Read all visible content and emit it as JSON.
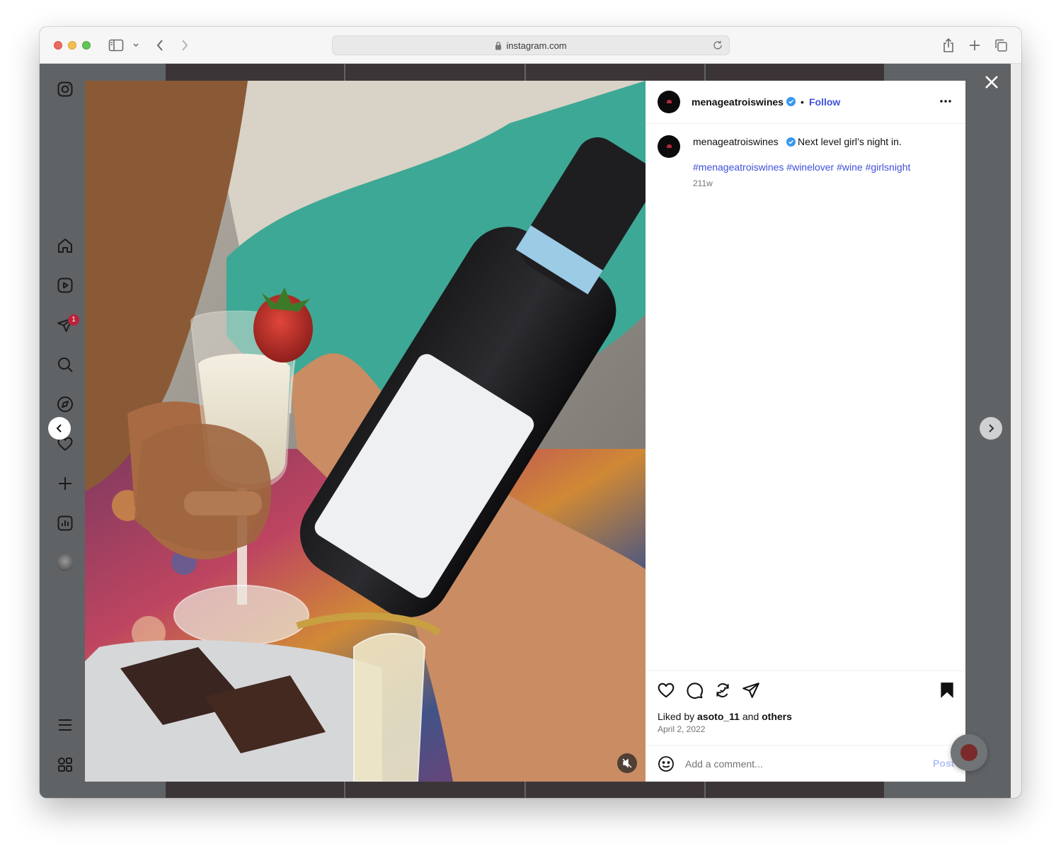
{
  "browser": {
    "url": "instagram.com"
  },
  "sidebar": {
    "notifications_badge": "1"
  },
  "post": {
    "author": "menageatroiswines",
    "follow_label": "Follow",
    "separator": "•",
    "caption": "Next level girl’s night in.",
    "hashtags": "#menageatroiswines #winelover #wine #girlsnight",
    "age": "211w",
    "liked_by_prefix": "Liked by",
    "liked_by_user": "asoto_11",
    "liked_by_and": "and",
    "liked_by_others": "others",
    "date": "April 2, 2022"
  },
  "comment": {
    "placeholder": "Add a comment...",
    "post_label": "Post"
  },
  "colors": {
    "link_blue": "#3f51d9",
    "verified_blue": "#3897f0",
    "overlay_gray": "#606366",
    "badge_red": "#b9233b"
  },
  "icons": {
    "sidebar": [
      "instagram-logo-icon",
      "home-icon",
      "reels-icon",
      "messages-icon",
      "search-icon",
      "explore-icon",
      "heart-icon",
      "create-icon",
      "insights-icon",
      "menu-icon",
      "threads-icon"
    ],
    "actions": [
      "like-icon",
      "comment-icon",
      "repost-icon",
      "share-icon",
      "save-icon"
    ]
  }
}
